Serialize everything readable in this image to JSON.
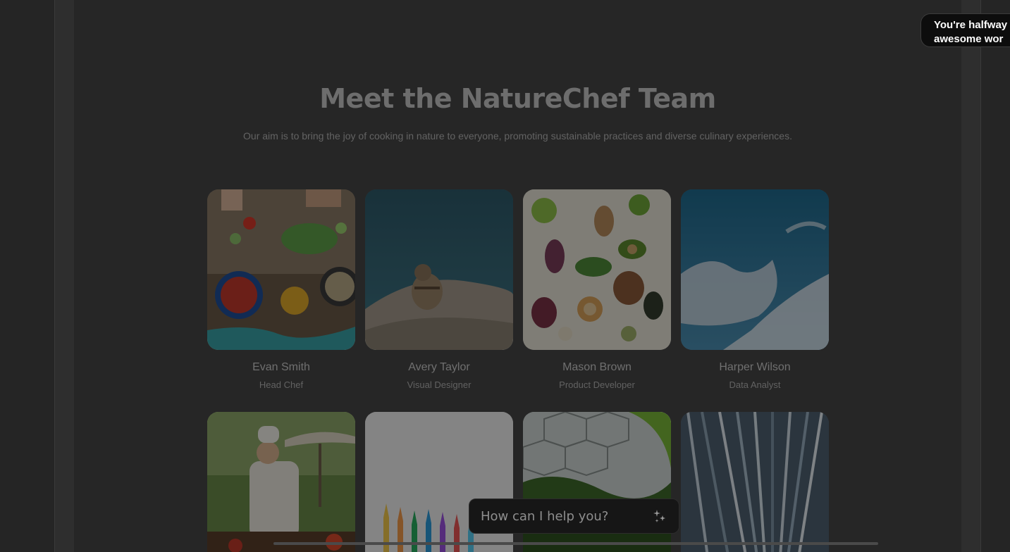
{
  "header": {
    "title": "Meet the NatureChef Team",
    "subtitle": "Our aim is to bring the joy of cooking in nature to everyone, promoting sustainable practices and diverse culinary experiences."
  },
  "team": [
    {
      "name": "Evan Smith",
      "role": "Head Chef"
    },
    {
      "name": "Avery Taylor",
      "role": "Visual Designer"
    },
    {
      "name": "Mason Brown",
      "role": "Product Developer"
    },
    {
      "name": "Harper Wilson",
      "role": "Data Analyst"
    }
  ],
  "toast": {
    "line1": "You're halfway",
    "line2": "awesome wor"
  },
  "assistant": {
    "placeholder": "How can I help you?",
    "icon": "sparkle-icon"
  },
  "colors": {
    "backdrop": "#252525",
    "toast_bg": "#0d0d0d",
    "assistant_bg": "#161616"
  }
}
